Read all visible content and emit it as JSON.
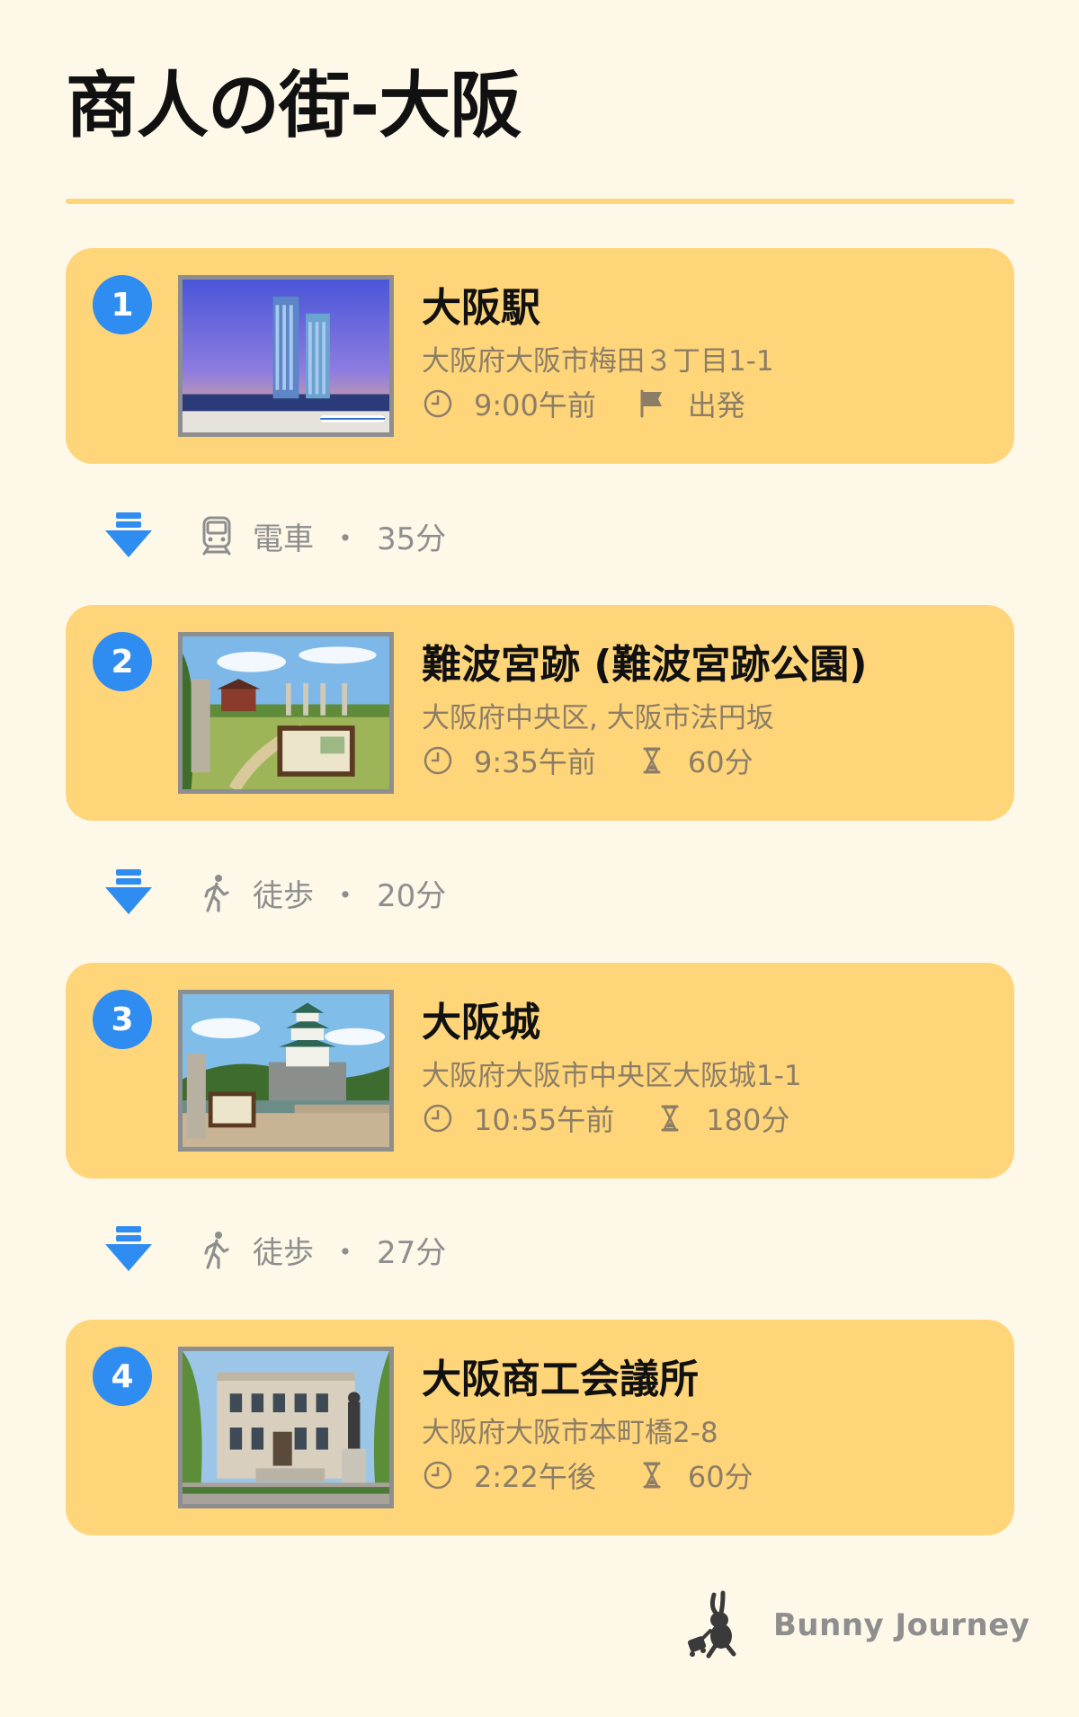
{
  "page_title": "商人の街-大阪",
  "stops": [
    {
      "number": "1",
      "name": "大阪駅",
      "address": "大阪府大阪市梅田３丁目1-1",
      "time": "9:00午前",
      "detail": "出発",
      "detail_icon": "flag-icon"
    },
    {
      "number": "2",
      "name": "難波宮跡 (難波宮跡公園)",
      "address": "大阪府中央区, 大阪市法円坂",
      "time": "9:35午前",
      "detail": "60分",
      "detail_icon": "hourglass-icon"
    },
    {
      "number": "3",
      "name": "大阪城",
      "address": "大阪府大阪市中央区大阪城1-1",
      "time": "10:55午前",
      "detail": "180分",
      "detail_icon": "hourglass-icon"
    },
    {
      "number": "4",
      "name": "大阪商工会議所",
      "address": "大阪府大阪市本町橋2-8",
      "time": "2:22午後",
      "detail": "60分",
      "detail_icon": "hourglass-icon"
    }
  ],
  "transits": [
    {
      "mode": "電車",
      "separator": "・",
      "duration": "35分",
      "icon": "train-icon"
    },
    {
      "mode": "徒歩",
      "separator": "・",
      "duration": "20分",
      "icon": "walking-icon"
    },
    {
      "mode": "徒歩",
      "separator": "・",
      "duration": "27分",
      "icon": "walking-icon"
    }
  ],
  "footer": {
    "brand": "Bunny Journey"
  },
  "colors": {
    "background": "#FEF8E8",
    "card": "#FFD57A",
    "accent_blue": "#2F8CF0",
    "muted_text": "#8C7E66"
  }
}
